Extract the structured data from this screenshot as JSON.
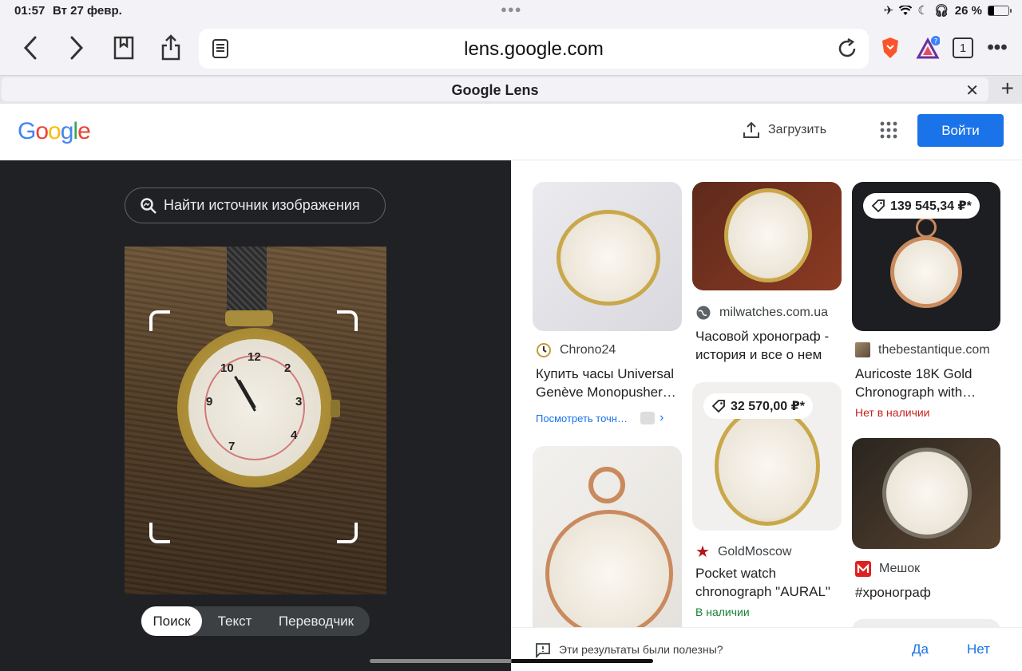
{
  "status_bar": {
    "time": "01:57",
    "date": "Вт 27 февр.",
    "battery_text": "26 %",
    "battery_level": 0.26
  },
  "browser": {
    "url": "lens.google.com",
    "tab_title": "Google Lens",
    "tab_count": "1"
  },
  "header": {
    "logo": "Google",
    "upload_label": "Загрузить",
    "signin_label": "Войти"
  },
  "lens": {
    "find_source_label": "Найти источник изображения",
    "modes": [
      "Поиск",
      "Текст",
      "Переводчик"
    ],
    "active_mode": "Поиск"
  },
  "results": [
    {
      "source": "Chrono24",
      "title": "Купить часы Universal Genève Monopusher…",
      "link": "Посмотреть точн…"
    },
    {
      "source": "milwatches.com.ua",
      "title": "Часовой хронограф - история и все о нем"
    },
    {
      "price": "139 545,34 ₽*",
      "source": "thebestantique.com",
      "title": "Auricoste 18K Gold Chronograph with…",
      "stock": "Нет в наличии"
    },
    {
      "price": "32 570,00 ₽*",
      "source": "GoldMoscow",
      "title": "Pocket watch chronograph \"AURAL\"",
      "stock": "В наличии"
    },
    {
      "source": "Мешок",
      "title": "#хронограф"
    }
  ],
  "feedback": {
    "question": "Эти результаты были полезны?",
    "yes": "Да",
    "no": "Нет"
  },
  "colors": {
    "google_blue": "#4285F4",
    "google_red": "#EA4335",
    "google_yellow": "#FBBC05",
    "google_green": "#34A853",
    "button_blue": "#1a73e8",
    "out_of_stock": "#c5221f",
    "in_stock": "#188038"
  }
}
